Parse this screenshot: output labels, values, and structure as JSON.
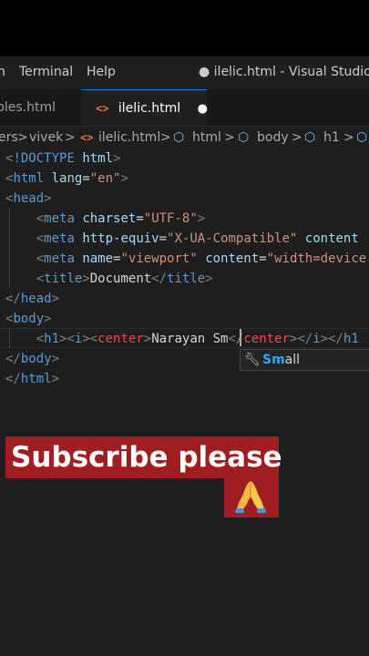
{
  "menubar": {
    "items": [
      "n",
      "Terminal",
      "Help"
    ],
    "title": "● ilelic.html - Visual Studio Code"
  },
  "tabs": [
    {
      "label": "ples.html",
      "active": false
    },
    {
      "label": "ilelic.html",
      "active": true,
      "icon": "<>",
      "dirty_marker": "●"
    }
  ],
  "breadcrumb": {
    "items": [
      "ers",
      "vivek",
      "ilelic.html",
      "html",
      "body",
      "h1"
    ],
    "separator": ">"
  },
  "editor": {
    "lines": [
      {
        "parts": [
          [
            "p",
            "<"
          ],
          [
            "t",
            "!DOCTYPE"
          ],
          [
            "x",
            " "
          ],
          [
            "a",
            "html"
          ],
          [
            "p",
            ">"
          ]
        ]
      },
      {
        "parts": [
          [
            "p",
            "<"
          ],
          [
            "t",
            "html"
          ],
          [
            "x",
            " "
          ],
          [
            "a",
            "lang"
          ],
          [
            "x",
            "="
          ],
          [
            "s",
            "\"en\""
          ],
          [
            "p",
            ">"
          ]
        ]
      },
      {
        "parts": [
          [
            "p",
            "<"
          ],
          [
            "t",
            "head"
          ],
          [
            "p",
            ">"
          ]
        ]
      },
      {
        "parts": [
          [
            "x",
            "    "
          ],
          [
            "p",
            "<"
          ],
          [
            "t",
            "meta"
          ],
          [
            "x",
            " "
          ],
          [
            "a",
            "charset"
          ],
          [
            "x",
            "="
          ],
          [
            "s",
            "\"UTF-8\""
          ],
          [
            "p",
            ">"
          ]
        ]
      },
      {
        "parts": [
          [
            "x",
            "    "
          ],
          [
            "p",
            "<"
          ],
          [
            "t",
            "meta"
          ],
          [
            "x",
            " "
          ],
          [
            "a",
            "http-equiv"
          ],
          [
            "x",
            "="
          ],
          [
            "s",
            "\"X-UA-Compatible\""
          ],
          [
            "x",
            " "
          ],
          [
            "a",
            "content"
          ]
        ]
      },
      {
        "parts": [
          [
            "x",
            "    "
          ],
          [
            "p",
            "<"
          ],
          [
            "t",
            "meta"
          ],
          [
            "x",
            " "
          ],
          [
            "a",
            "name"
          ],
          [
            "x",
            "="
          ],
          [
            "s",
            "\"viewport\""
          ],
          [
            "x",
            " "
          ],
          [
            "a",
            "content"
          ],
          [
            "x",
            "="
          ],
          [
            "s",
            "\"width=device-"
          ]
        ]
      },
      {
        "parts": [
          [
            "x",
            "    "
          ],
          [
            "p",
            "<"
          ],
          [
            "t",
            "title"
          ],
          [
            "p",
            ">"
          ],
          [
            "x",
            "Document"
          ],
          [
            "p",
            "</"
          ],
          [
            "t",
            "title"
          ],
          [
            "p",
            ">"
          ]
        ]
      },
      {
        "parts": [
          [
            "p",
            "</"
          ],
          [
            "t",
            "head"
          ],
          [
            "p",
            ">"
          ]
        ]
      },
      {
        "parts": [
          [
            "p",
            "<"
          ],
          [
            "t",
            "body"
          ],
          [
            "p",
            ">"
          ]
        ]
      },
      {
        "parts": [
          [
            "x",
            "    "
          ],
          [
            "p",
            "<"
          ],
          [
            "t",
            "h1"
          ],
          [
            "p",
            "><"
          ],
          [
            "t",
            "i"
          ],
          [
            "p",
            "><"
          ],
          [
            "e",
            "center"
          ],
          [
            "p",
            ">"
          ],
          [
            "x",
            "Narayan Sm"
          ],
          [
            "p",
            "</"
          ],
          [
            "e",
            "center"
          ],
          [
            "p",
            "></"
          ],
          [
            "t",
            "i"
          ],
          [
            "p",
            "></"
          ],
          [
            "t",
            "h1"
          ]
        ]
      },
      {
        "parts": [
          [
            "p",
            "</"
          ],
          [
            "t",
            "body"
          ],
          [
            "p",
            ">"
          ]
        ]
      },
      {
        "parts": [
          [
            "p",
            "</"
          ],
          [
            "t",
            "html"
          ],
          [
            "p",
            ">"
          ]
        ]
      }
    ]
  },
  "autocomplete": {
    "match": "Sm",
    "rest": "all",
    "icon": "wrench-icon"
  },
  "overlay": {
    "banner": "Subscribe please",
    "emoji": "🙏"
  },
  "colors": {
    "banner_bg": "#a01e22",
    "tag": "#569cd6",
    "attr": "#9cdcfe",
    "string": "#ce9178"
  }
}
